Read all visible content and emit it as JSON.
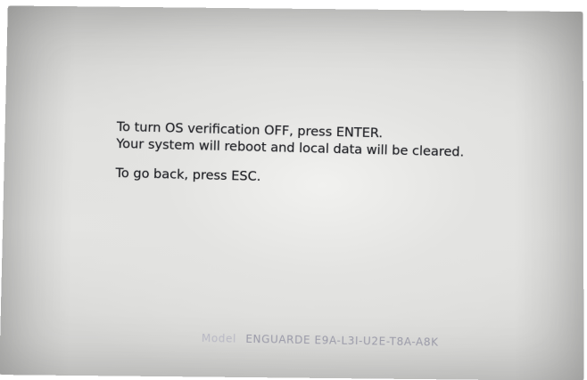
{
  "screen": {
    "message_line_1": "To turn OS verification OFF, press ENTER.",
    "message_line_2": "Your system will reboot and local data will be cleared.",
    "message_line_3": "To go back, press ESC.",
    "model_label": "Model",
    "model_value": "ENGUARDE E9A-L3I-U2E-T8A-A8K"
  },
  "colors": {
    "text": "#1e1f24",
    "model_text": "#9a9aa8",
    "screen_background": "#e3e3e1"
  }
}
